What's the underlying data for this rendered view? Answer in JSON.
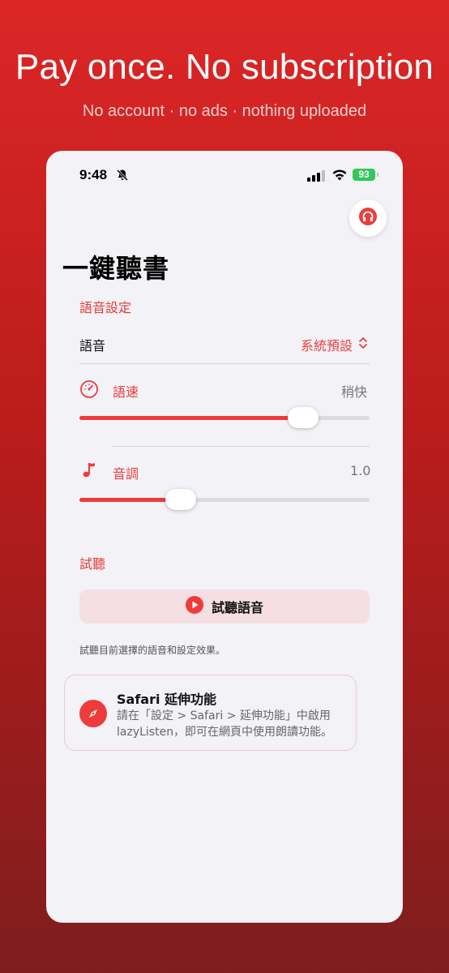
{
  "headline": "Pay once. No subscription",
  "subheadline": "No account · no ads · nothing uploaded",
  "status_bar": {
    "time": "9:48",
    "battery": "93"
  },
  "icons": {
    "mute": "bell-slash-icon",
    "signal": "cellular-signal-icon",
    "wifi": "wifi-icon",
    "headphones": "headphones-icon",
    "speedometer": "speedometer-icon",
    "music": "music-note-icon",
    "play": "play-icon",
    "compass": "safari-compass-icon",
    "chevron": "chevron-up-down-icon"
  },
  "colors": {
    "accent": "#ef3b3b",
    "background_top": "#dc2626",
    "background_bottom": "#7f1d1d"
  },
  "page_title": "一鍵聽書",
  "voice_settings": {
    "section_label": "語音設定",
    "voice_label": "語音",
    "voice_value": "系統預設",
    "rate_label": "語速",
    "rate_value": "稍快",
    "rate_level": 0.77,
    "pitch_label": "音調",
    "pitch_value": "1.0",
    "pitch_level": 0.35
  },
  "preview": {
    "section_label": "試聽",
    "button_label": "試聽語音",
    "helper_text": "試聽目前選擇的語音和設定效果。"
  },
  "safari_card": {
    "title": "Safari 延伸功能",
    "body": "請在「設定 > Safari > 延伸功能」中啟用 lazyListen，即可在網頁中使用朗讀功能。"
  }
}
